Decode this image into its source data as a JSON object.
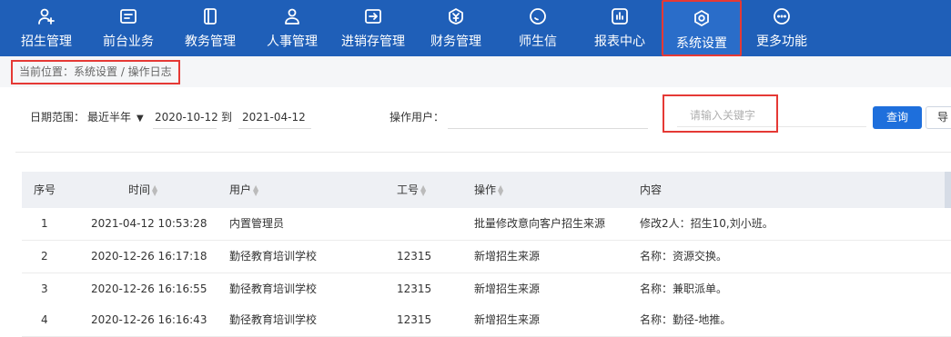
{
  "nav": {
    "items": [
      {
        "label": "招生管理",
        "icon": "person-add-icon"
      },
      {
        "label": "前台业务",
        "icon": "monitor-icon"
      },
      {
        "label": "教务管理",
        "icon": "book-icon"
      },
      {
        "label": "人事管理",
        "icon": "person-icon"
      },
      {
        "label": "进销存管理",
        "icon": "box-arrow-icon"
      },
      {
        "label": "财务管理",
        "icon": "yuan-shield-icon"
      },
      {
        "label": "师生信",
        "icon": "chat-icon"
      },
      {
        "label": "报表中心",
        "icon": "bar-chart-icon"
      },
      {
        "label": "系统设置",
        "icon": "gear-icon",
        "active": true
      },
      {
        "label": "更多功能",
        "icon": "more-icon"
      }
    ]
  },
  "breadcrumb": "当前位置：系统设置 / 操作日志",
  "filters": {
    "date_label": "日期范围：",
    "date_range_select": "最近半年",
    "date_from": "2020-10-12",
    "date_to_sep": "到",
    "date_to": "2021-04-12",
    "user_label": "操作用户：",
    "user_value": "",
    "keyword_placeholder": "请输入关键字",
    "query_button": "查询",
    "export_button": "导"
  },
  "table": {
    "headers": [
      "序号",
      "时间",
      "用户",
      "工号",
      "操作",
      "内容"
    ],
    "rows": [
      [
        "1",
        "2021-04-12 10:53:28",
        "内置管理员",
        "",
        "批量修改意向客户招生来源",
        "修改2人：招生10,刘小班。"
      ],
      [
        "2",
        "2020-12-26 16:17:18",
        "勤径教育培训学校",
        "12315",
        "新增招生来源",
        "名称：资源交换。"
      ],
      [
        "3",
        "2020-12-26 16:16:55",
        "勤径教育培训学校",
        "12315",
        "新增招生来源",
        "名称：兼职派单。"
      ],
      [
        "4",
        "2020-12-26 16:16:43",
        "勤径教育培训学校",
        "12315",
        "新增招生来源",
        "名称：勤径-地推。"
      ]
    ]
  },
  "colors": {
    "nav_bg": "#1f5fb8",
    "accent": "#1e6fdc",
    "highlight": "#e53935"
  }
}
